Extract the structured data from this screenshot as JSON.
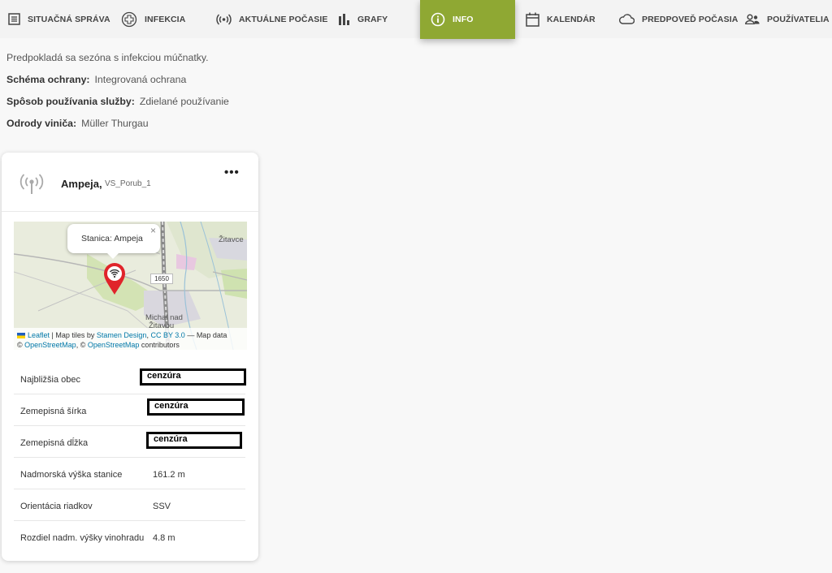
{
  "nav": {
    "items": [
      {
        "label": "SITUAČNÁ SPRÁVA",
        "icon": "list-icon"
      },
      {
        "label": "INFEKCIA",
        "icon": "plus-circle-icon"
      },
      {
        "label": "AKTUÁLNE POČASIE",
        "icon": "broadcast-icon"
      },
      {
        "label": "GRAFY",
        "icon": "bar-chart-icon"
      },
      {
        "label": "INFO",
        "icon": "info-icon",
        "active": true
      },
      {
        "label": "KALENDÁR",
        "icon": "calendar-icon"
      },
      {
        "label": "PREDPOVEĎ POČASIA",
        "icon": "cloud-icon"
      },
      {
        "label": "POUŽÍVATELIA",
        "icon": "users-icon"
      }
    ],
    "active_color": "#8fa833"
  },
  "intro": {
    "season_text": "Predpokladá sa sezóna s infekciou múčnatky.",
    "scheme_label": "Schéma ochrany:",
    "scheme_value": "Integrovaná ochrana",
    "usage_label": "Spôsob používania služby:",
    "usage_value": "Zdielané používanie",
    "variety_label": "Odrody viniča:",
    "variety_value": "Müller Thurgau"
  },
  "card": {
    "station_name": "Ampeja,",
    "station_code": "VS_Porub_1",
    "more_label": "•••",
    "map": {
      "popup_text": "Stanica: Ampeja",
      "popup_close": "×",
      "town_1": "Žitavce",
      "town_2a": "Michal nad",
      "town_2b": "Žitavou",
      "road_number": "1650",
      "attribution": {
        "leaflet": "Leaflet",
        "sep1": " | Map tiles by ",
        "stamen": "Stamen Design",
        "sep2": ", ",
        "license": "CC BY 3.0",
        "sep3": " — Map data",
        "copy1": "© ",
        "osm1": "OpenStreetMap",
        "sep4": ", © ",
        "osm2": "OpenStreetMap",
        "sep5": " contributors"
      }
    },
    "rows": [
      {
        "label": "Najbližšia obec",
        "value": "cenzúra",
        "redacted": true
      },
      {
        "label": "Zemepisná šírka",
        "value": "cenzúra",
        "redacted": true
      },
      {
        "label": "Zemepisná dĺžka",
        "value": "cenzúra",
        "redacted": true
      },
      {
        "label": "Nadmorská výška stanice",
        "value": "161.2 m"
      },
      {
        "label": "Orientácia riadkov",
        "value": "SSV"
      },
      {
        "label": "Rozdiel nadm. výšky vinohradu",
        "value": "4.8 m"
      }
    ]
  }
}
